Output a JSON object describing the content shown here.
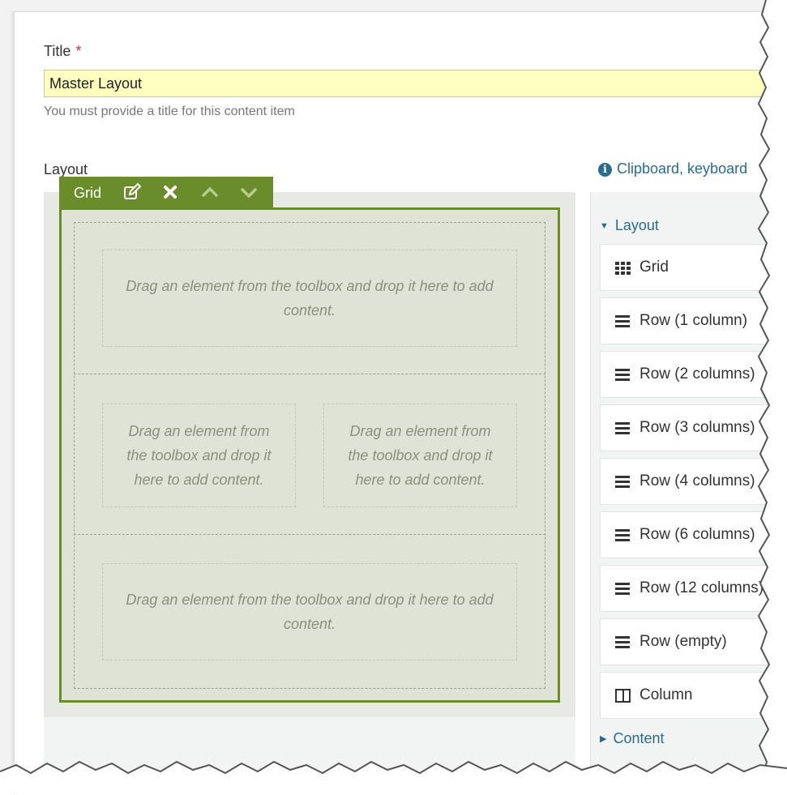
{
  "form": {
    "title_label": "Title",
    "required_mark": "*",
    "title_value": "Master Layout",
    "title_hint": "You must provide a title for this content item",
    "layout_label": "Layout",
    "help_link": "Clipboard, keyboard"
  },
  "grid": {
    "toolbar_label": "Grid",
    "drop_text": "Drag an element from the toolbox and drop it here to add content.",
    "colors": {
      "accent": "#6a8c2a",
      "fill": "#dfe3d6"
    }
  },
  "toolbox": {
    "layout_category": "Layout",
    "content_category": "Content",
    "items": [
      {
        "label": "Grid",
        "icon": "grid-icon"
      },
      {
        "label": "Row (1 column)",
        "icon": "bars-icon"
      },
      {
        "label": "Row (2 columns)",
        "icon": "bars-icon"
      },
      {
        "label": "Row (3 columns)",
        "icon": "bars-icon"
      },
      {
        "label": "Row (4 columns)",
        "icon": "bars-icon"
      },
      {
        "label": "Row (6 columns)",
        "icon": "bars-icon"
      },
      {
        "label": "Row (12 columns)",
        "icon": "bars-icon"
      },
      {
        "label": "Row (empty)",
        "icon": "bars-icon"
      },
      {
        "label": "Column",
        "icon": "column-icon"
      }
    ]
  }
}
